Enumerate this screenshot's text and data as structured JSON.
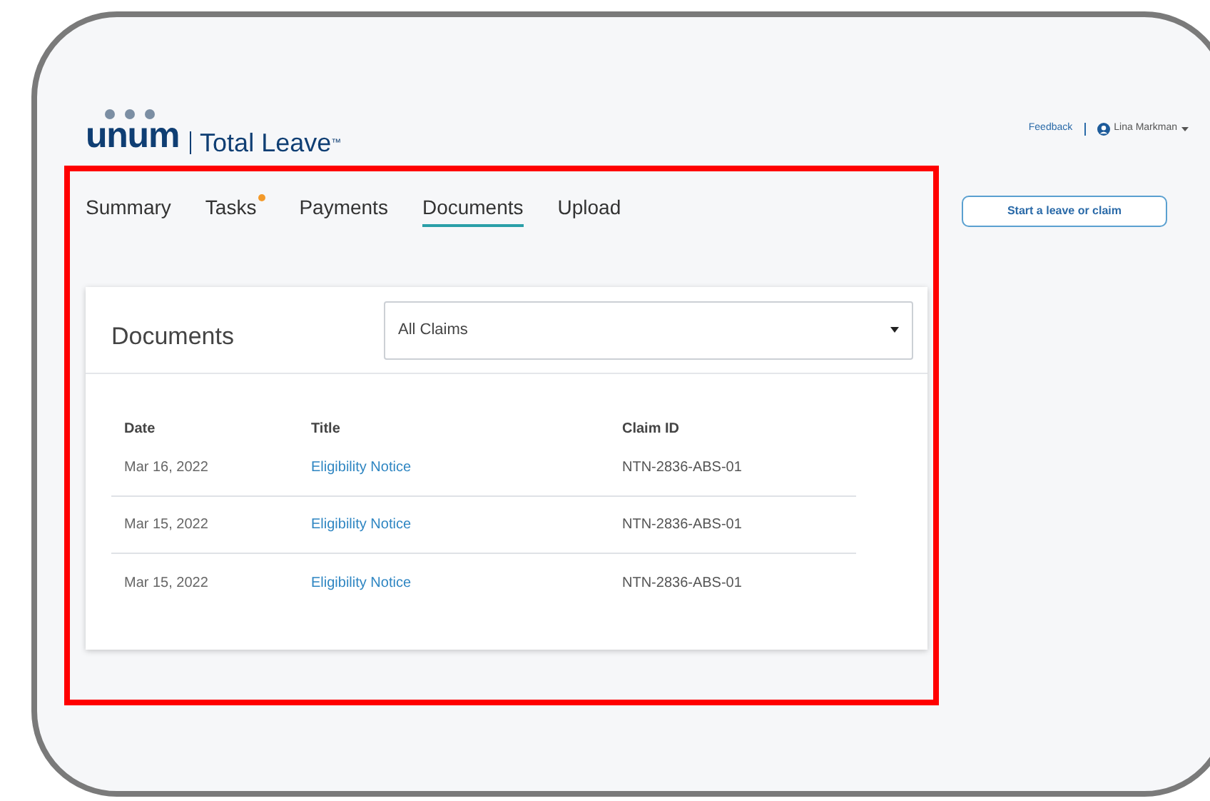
{
  "header": {
    "logo": "unum",
    "product": "Total Leave$^{™}$",
    "feedback": "Feedback",
    "user": "Lina Markman"
  },
  "tabs": [
    {
      "label": "Summary",
      "selected": false,
      "notification": false
    },
    {
      "label": "Tasks",
      "selected": false,
      "notification": true
    },
    {
      "label": "Payments",
      "selected": false,
      "notification": false
    },
    {
      "label": "Documents",
      "selected": true,
      "notification": false
    },
    {
      "label": "Upload",
      "selected": false,
      "notification": false
    }
  ],
  "start_button": "Start a leave or claim",
  "documents": {
    "title": "Documents",
    "filter": "All Claims",
    "columns": [
      "Date",
      "Title",
      "Claim ID"
    ],
    "rows": [
      {
        "date": "Mar 16, 2022",
        "title": "Eligibility Notice",
        "claim_id": "NTN-2836-ABS-01"
      },
      {
        "date": "Mar 15, 2022",
        "title": "Eligibility Notice",
        "claim_id": "NTN-2836-ABS-01"
      },
      {
        "date": "Mar 15, 2022",
        "title": "Eligibility Notice",
        "claim_id": "NTN-2836-ABS-01"
      }
    ]
  }
}
